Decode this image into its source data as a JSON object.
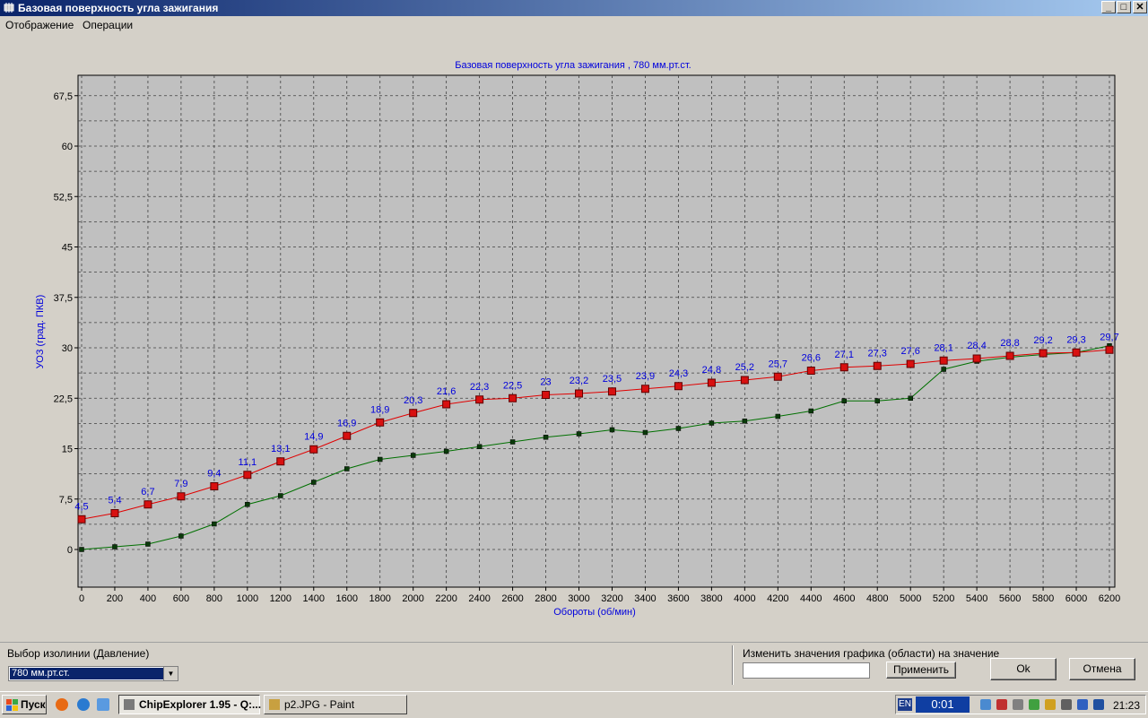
{
  "window": {
    "title": "Базовая поверхность угла зажигания",
    "btn_min": "_",
    "btn_max": "□",
    "btn_close": "✕"
  },
  "menu": {
    "items": [
      "Отображение",
      "Операции"
    ]
  },
  "colors": {
    "plot_bg": "#c0c0c0",
    "series_red": "#e00000",
    "series_green": "#007000",
    "label_blue": "#0000dd",
    "title_bar": "#0a246a"
  },
  "chart_data": {
    "type": "line",
    "title": "Базовая поверхность угла зажигания , 780 мм.рт.ст.",
    "xlabel": "Обороты (об/мин)",
    "ylabel": "УОЗ (град. ПКВ)",
    "xlim": [
      0,
      6200
    ],
    "ylim": [
      -5,
      70
    ],
    "grid": true,
    "x_ticks": [
      0,
      200,
      400,
      600,
      800,
      1000,
      1200,
      1400,
      1600,
      1800,
      2000,
      2200,
      2400,
      2600,
      2800,
      3000,
      3200,
      3400,
      3600,
      3800,
      4000,
      4200,
      4400,
      4600,
      4800,
      5000,
      5200,
      5400,
      5600,
      5800,
      6000,
      6200
    ],
    "y_ticks": [
      0,
      7.5,
      15,
      22.5,
      30,
      37.5,
      45,
      52.5,
      60,
      67.5
    ],
    "y_tick_labels": [
      "0",
      "7,5",
      "15",
      "22,5",
      "30",
      "37,5",
      "45",
      "52,5",
      "60",
      "67,5"
    ],
    "x": [
      0,
      200,
      400,
      600,
      800,
      1000,
      1200,
      1400,
      1600,
      1800,
      2000,
      2200,
      2400,
      2600,
      2800,
      3000,
      3200,
      3400,
      3600,
      3800,
      4000,
      4200,
      4400,
      4600,
      4800,
      5000,
      5200,
      5400,
      5600,
      5800,
      6000,
      6200
    ],
    "series": [
      {
        "color": "red",
        "values": [
          4.5,
          5.4,
          6.7,
          7.9,
          9.4,
          11.1,
          13.1,
          14.9,
          16.9,
          18.9,
          20.3,
          21.6,
          22.3,
          22.5,
          23,
          23.2,
          23.5,
          23.9,
          24.3,
          24.8,
          25.2,
          25.7,
          26.6,
          27.1,
          27.3,
          27.6,
          28.1,
          28.4,
          28.8,
          29.2,
          29.3,
          29.7
        ],
        "labels": [
          "4,5",
          "5,4",
          "6,7",
          "7,9",
          "9,4",
          "11,1",
          "13,1",
          "14,9",
          "16,9",
          "18,9",
          "20,3",
          "21,6",
          "22,3",
          "22,5",
          "23",
          "23,2",
          "23,5",
          "23,9",
          "24,3",
          "24,8",
          "25,2",
          "25,7",
          "26,6",
          "27,1",
          "27,3",
          "27,6",
          "28,1",
          "28,4",
          "28,8",
          "29,2",
          "29,3",
          "29,7"
        ]
      },
      {
        "color": "green",
        "values": [
          0,
          0.4,
          0.8,
          2.0,
          3.8,
          6.7,
          8.0,
          10.0,
          12.0,
          13.4,
          14.0,
          14.6,
          15.3,
          16.0,
          16.7,
          17.2,
          17.8,
          17.4,
          18.0,
          18.8,
          19.1,
          19.8,
          20.6,
          22.1,
          22.1,
          22.5,
          26.8,
          28.0,
          28.6,
          29.0,
          29.3,
          30.3
        ]
      }
    ]
  },
  "bottom": {
    "isoline_label": "Выбор изолинии (Давление)",
    "isoline_value": "780 мм.рт.ст.",
    "change_label": "Изменить значения графика (области) на значение",
    "change_value": "",
    "apply_button": "Применить",
    "ok_button": "Ok",
    "cancel_button": "Отмена"
  },
  "taskbar": {
    "start_label": "Пуск",
    "tasks": [
      "ChipExplorer  1.95 - Q:...",
      "p2.JPG - Paint"
    ],
    "lang": "EN",
    "timer": "0:01",
    "clock": "21:23"
  }
}
